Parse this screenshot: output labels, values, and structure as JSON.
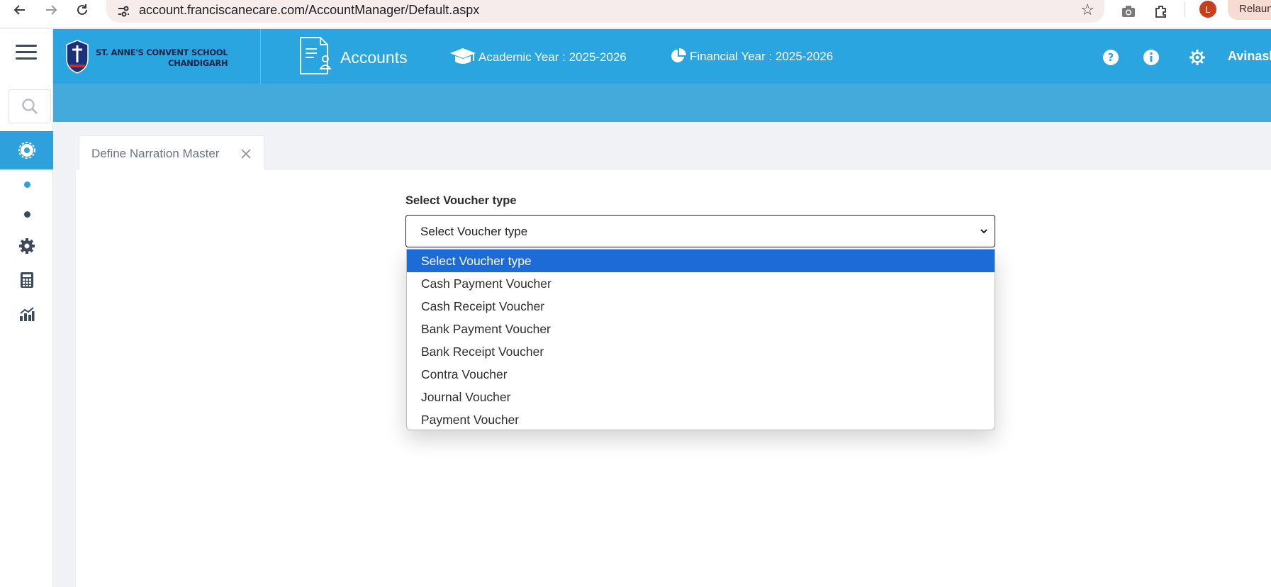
{
  "browser": {
    "url": "account.franciscanecare.com/AccountManager/Default.aspx",
    "profile_initial": "L",
    "relaunch_label": "Relaunch"
  },
  "header": {
    "school_line1": "ST. ANNE'S CONVENT SCHOOL",
    "school_line2": "CHANDIGARH",
    "module_title": "Accounts",
    "academic_year": "Academic Year : 2025-2026",
    "financial_year": "Financial Year : 2025-2026",
    "user_name": "Avinash"
  },
  "tab": {
    "label": "Define Narration Master"
  },
  "form": {
    "voucher_label": "Select Voucher type",
    "selected_value": "Select Voucher type",
    "options": [
      "Select Voucher type",
      "Cash Payment Voucher",
      "Cash Receipt Voucher",
      "Bank Payment Voucher",
      "Bank Receipt Voucher",
      "Contra Voucher",
      "Journal Voucher",
      "Payment Voucher"
    ]
  },
  "colors": {
    "header_blue": "#2aa5e0",
    "subheader_blue": "#44aadb",
    "selected_option": "#1d6bd6",
    "avatar": "#c5401d"
  },
  "icons": {
    "rail": [
      "hamburger-icon",
      "search-icon",
      "gear-badge-icon",
      "dot-icon",
      "dot-icon",
      "settings-icon",
      "calculator-icon",
      "analytics-icon"
    ],
    "header": [
      "help-icon",
      "info-icon",
      "settings-icon"
    ]
  }
}
